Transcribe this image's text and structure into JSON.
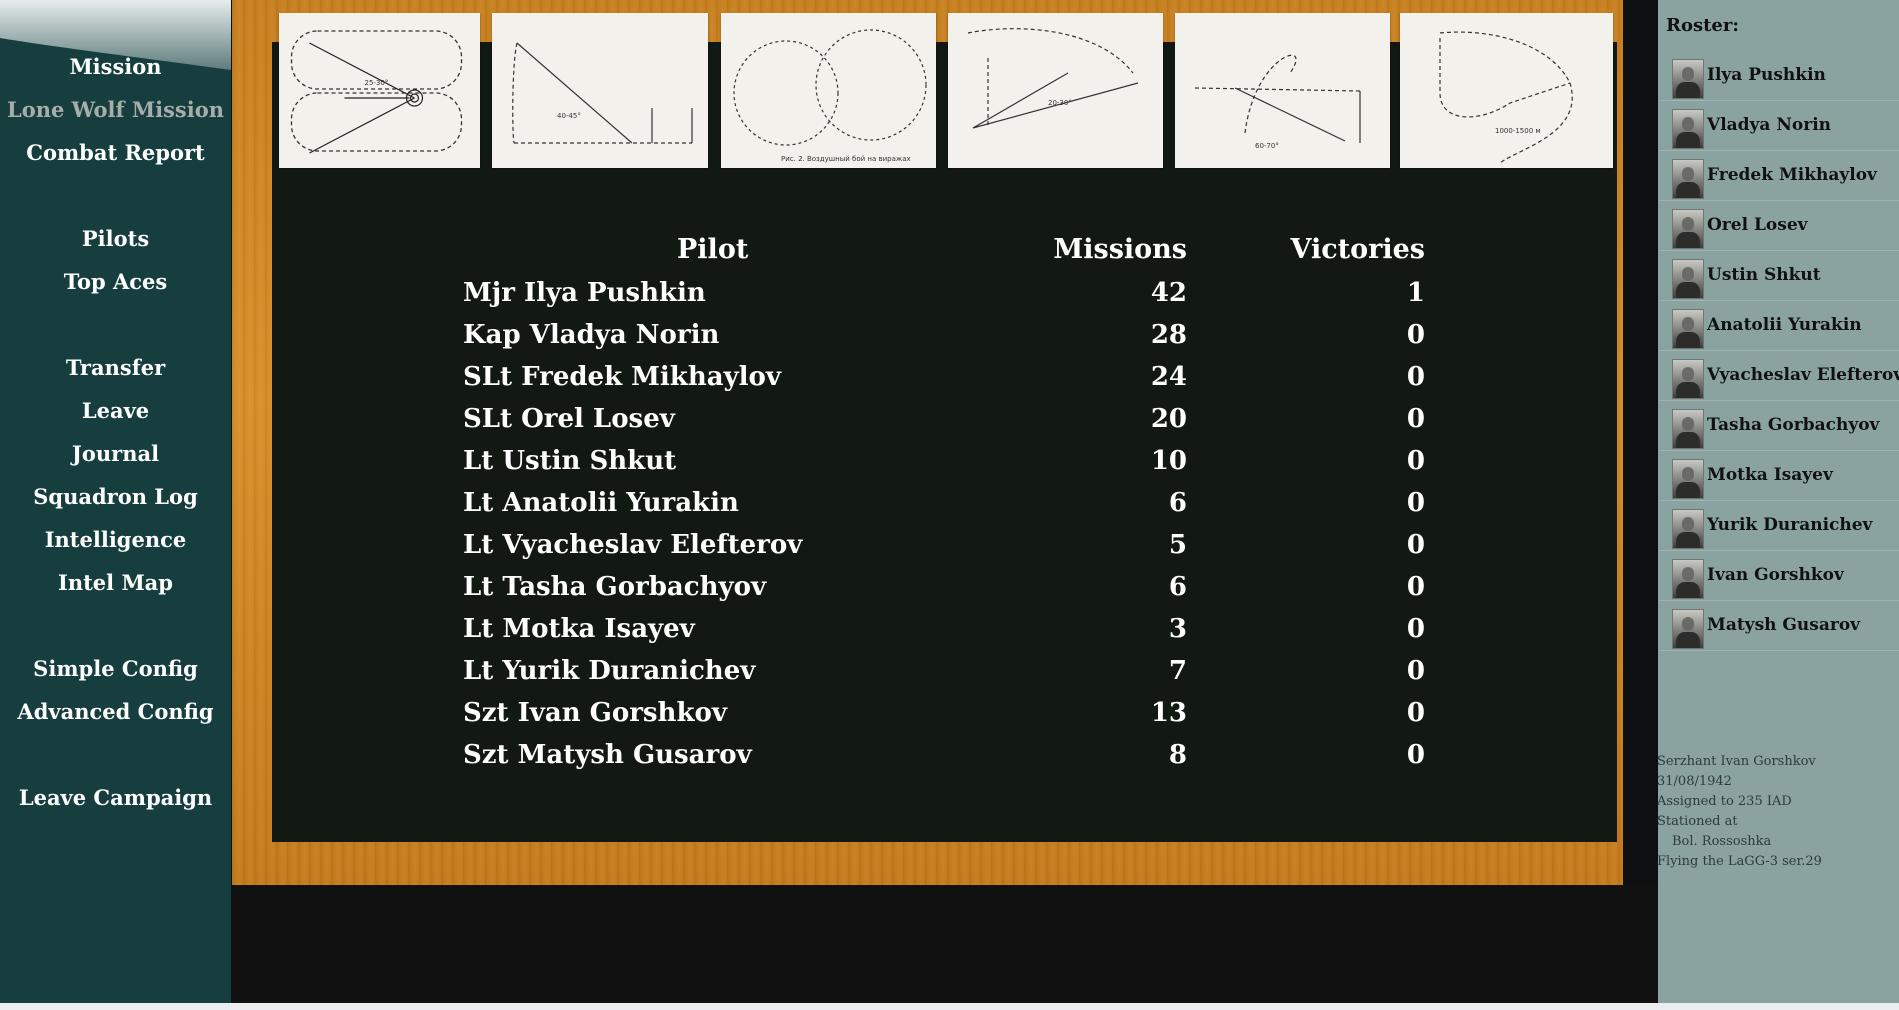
{
  "nav": {
    "mission": "Mission",
    "lone_wolf_mission": "Lone Wolf Mission",
    "combat_report": "Combat Report",
    "pilots": "Pilots",
    "top_aces": "Top Aces",
    "transfer": "Transfer",
    "leave": "Leave",
    "journal": "Journal",
    "squadron_log": "Squadron Log",
    "intelligence": "Intelligence",
    "intel_map": "Intel Map",
    "simple_config": "Simple Config",
    "advanced_config": "Advanced Config",
    "leave_campaign": "Leave Campaign"
  },
  "table": {
    "headers": {
      "pilot": "Pilot",
      "missions": "Missions",
      "victories": "Victories"
    },
    "rows": [
      {
        "pilot": "Mjr Ilya Pushkin",
        "missions": "42",
        "victories": "1"
      },
      {
        "pilot": "Kap Vladya Norin",
        "missions": "28",
        "victories": "0"
      },
      {
        "pilot": "SLt Fredek Mikhaylov",
        "missions": "24",
        "victories": "0"
      },
      {
        "pilot": "SLt Orel Losev",
        "missions": "20",
        "victories": "0"
      },
      {
        "pilot": "Lt Ustin Shkut",
        "missions": "10",
        "victories": "0"
      },
      {
        "pilot": "Lt Anatolii Yurakin",
        "missions": "6",
        "victories": "0"
      },
      {
        "pilot": "Lt Vyacheslav Elefterov",
        "missions": "5",
        "victories": "0"
      },
      {
        "pilot": "Lt Tasha Gorbachyov",
        "missions": "6",
        "victories": "0"
      },
      {
        "pilot": "Lt Motka Isayev",
        "missions": "3",
        "victories": "0"
      },
      {
        "pilot": "Lt Yurik Duranichev",
        "missions": "7",
        "victories": "0"
      },
      {
        "pilot": "Szt Ivan Gorshkov",
        "missions": "13",
        "victories": "0"
      },
      {
        "pilot": "Szt Matysh Gusarov",
        "missions": "8",
        "victories": "0"
      }
    ]
  },
  "roster": {
    "title": "Roster:",
    "items": [
      "Ilya Pushkin",
      "Vladya Norin",
      "Fredek Mikhaylov",
      "Orel Losev",
      "Ustin Shkut",
      "Anatolii Yurakin",
      "Vyacheslav Elefterov",
      "Tasha Gorbachyov",
      "Motka Isayev",
      "Yurik Duranichev",
      "Ivan Gorshkov",
      "Matysh Gusarov"
    ]
  },
  "status": {
    "name": "Serzhant Ivan Gorshkov",
    "date": "31/08/1942",
    "assigned": "Assigned to 235 IAD",
    "stationed": "Stationed at",
    "airfield": "Bol. Rossoshka",
    "aircraft": "Flying the LaGG-3 ser.29"
  },
  "colors": {
    "sidebar": "#173e3e",
    "wood": "#c77f1e",
    "chalkboard": "#121812",
    "roster_bg": "#8aa3a1"
  }
}
